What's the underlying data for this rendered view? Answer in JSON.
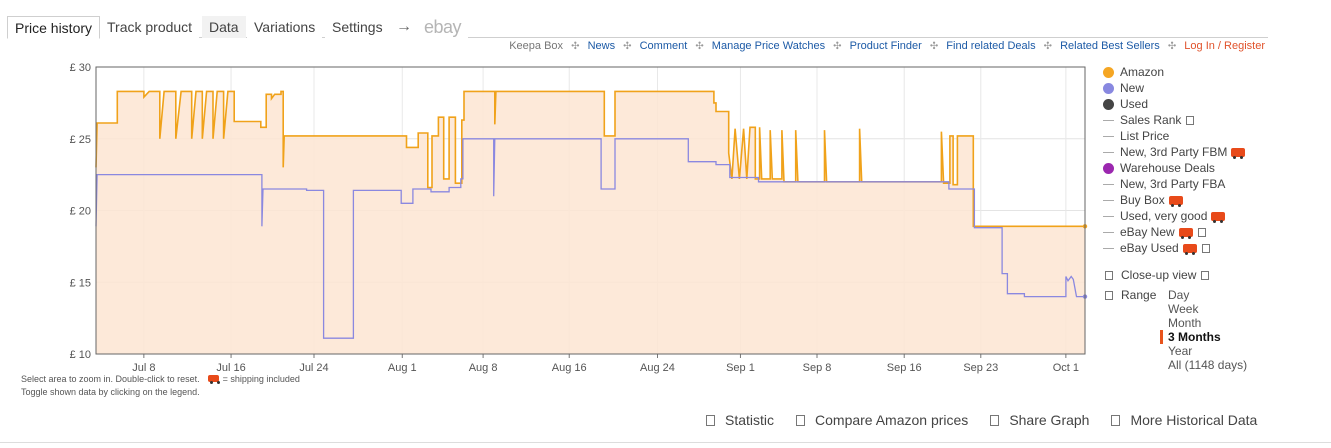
{
  "tabs": {
    "price_history": "Price history",
    "track_product": "Track product",
    "data": "Data",
    "variations": "Variations",
    "settings": "Settings",
    "arrow": "→",
    "ebay": "ebay"
  },
  "top_links": {
    "keepa_box": "Keepa Box",
    "news": "News",
    "comment": "Comment",
    "manage_price_watches": "Manage Price Watches",
    "product_finder": "Product Finder",
    "find_related_deals": "Find related Deals",
    "related_best_sellers": "Related Best Sellers",
    "login_register": "Log In / Register",
    "separator": "✣"
  },
  "chart_data": {
    "type": "line",
    "y_ticks": [
      "£ 30",
      "£ 25",
      "£ 20",
      "£ 15",
      "£ 10"
    ],
    "x_ticks": [
      "Jul 8",
      "Jul 16",
      "Jul 24",
      "Aug 1",
      "Aug 8",
      "Aug 16",
      "Aug 24",
      "Sep 1",
      "Sep 8",
      "Sep 16",
      "Sep 23",
      "Oct 1"
    ],
    "ylim": [
      10,
      30
    ],
    "x_range_days": [
      0,
      93
    ],
    "x_unit": "days from Jul 4",
    "grid": true,
    "colors": {
      "amazon": "#f0a21a",
      "new": "#8a88e0",
      "fill": "#fde5d2"
    },
    "series": [
      {
        "name": "Amazon",
        "points": [
          [
            0,
            23.0
          ],
          [
            0.1,
            26.1
          ],
          [
            2,
            26.1
          ],
          [
            2,
            28.3
          ],
          [
            4.5,
            28.3
          ],
          [
            4.5,
            27.9
          ],
          [
            5,
            28.3
          ],
          [
            6,
            28.3
          ],
          [
            6,
            25.0
          ],
          [
            6.4,
            28.3
          ],
          [
            7.5,
            28.3
          ],
          [
            7.5,
            25.0
          ],
          [
            8,
            28.3
          ],
          [
            9,
            28.3
          ],
          [
            9,
            25.0
          ],
          [
            9.4,
            28.3
          ],
          [
            10,
            28.3
          ],
          [
            10,
            25.0
          ],
          [
            10.4,
            28.3
          ],
          [
            11,
            28.3
          ],
          [
            11,
            25.0
          ],
          [
            11.4,
            28.3
          ],
          [
            12,
            28.3
          ],
          [
            12,
            25.0
          ],
          [
            12.4,
            28.3
          ],
          [
            13,
            28.3
          ],
          [
            13,
            26.2
          ],
          [
            15.5,
            26.2
          ],
          [
            15.5,
            25.8
          ],
          [
            16,
            25.8
          ],
          [
            16,
            28.1
          ],
          [
            16.5,
            28.1
          ],
          [
            16.5,
            27.8
          ],
          [
            16.8,
            28.1
          ],
          [
            17.4,
            28.1
          ],
          [
            17.4,
            28.3
          ],
          [
            17.6,
            28.3
          ],
          [
            17.6,
            23.0
          ],
          [
            17.7,
            25.2
          ],
          [
            29.2,
            25.2
          ],
          [
            29.2,
            24.4
          ],
          [
            30.3,
            24.4
          ],
          [
            30.3,
            25.4
          ],
          [
            31.2,
            25.4
          ],
          [
            31.2,
            21.6
          ],
          [
            31.6,
            21.6
          ],
          [
            31.6,
            25.2
          ],
          [
            32.2,
            25.2
          ],
          [
            32.2,
            26.5
          ],
          [
            32.7,
            26.5
          ],
          [
            32.7,
            22.2
          ],
          [
            33.2,
            22.2
          ],
          [
            33.2,
            26.5
          ],
          [
            33.8,
            26.5
          ],
          [
            33.8,
            21.9
          ],
          [
            34.4,
            21.9
          ],
          [
            34.4,
            26.3
          ],
          [
            34.6,
            26.3
          ],
          [
            34.6,
            28.3
          ],
          [
            37.5,
            28.3
          ],
          [
            37.5,
            26.0
          ],
          [
            37.6,
            28.3
          ],
          [
            47.8,
            28.3
          ],
          [
            47.8,
            25.2
          ],
          [
            48.8,
            25.2
          ],
          [
            48.8,
            28.3
          ],
          [
            58.1,
            28.3
          ],
          [
            58.1,
            27.5
          ],
          [
            58.3,
            27.5
          ],
          [
            58.3,
            26.9
          ],
          [
            59.5,
            26.9
          ],
          [
            59.5,
            24.0
          ],
          [
            59.8,
            22.2
          ],
          [
            60.1,
            25.7
          ],
          [
            60.5,
            22.2
          ],
          [
            60.9,
            25.7
          ],
          [
            61.2,
            22.2
          ],
          [
            61.5,
            25.8
          ],
          [
            62,
            25.8
          ],
          [
            62,
            22.2
          ],
          [
            62.4,
            22.2
          ],
          [
            62.4,
            25.8
          ],
          [
            62.6,
            22.2
          ],
          [
            63.4,
            22.2
          ],
          [
            63.4,
            25.6
          ],
          [
            63.6,
            22.2
          ],
          [
            64.5,
            22.2
          ],
          [
            64.5,
            25.6
          ],
          [
            64.7,
            22.0
          ],
          [
            65.8,
            22.0
          ],
          [
            65.8,
            25.6
          ],
          [
            66,
            22.0
          ],
          [
            68.5,
            22.0
          ],
          [
            68.5,
            25.6
          ],
          [
            68.7,
            22.0
          ],
          [
            71.8,
            22.0
          ],
          [
            71.8,
            25.7
          ],
          [
            72,
            22.0
          ],
          [
            79.5,
            22.0
          ],
          [
            79.5,
            25.5
          ],
          [
            79.7,
            21.9
          ],
          [
            80.3,
            21.9
          ],
          [
            80.3,
            25.2
          ],
          [
            80.6,
            25.2
          ],
          [
            80.6,
            21.8
          ],
          [
            81,
            21.8
          ],
          [
            81,
            25.2
          ],
          [
            82.5,
            25.2
          ],
          [
            82.5,
            18.9
          ],
          [
            93,
            18.9
          ]
        ]
      },
      {
        "name": "New",
        "points": [
          [
            0,
            18.9
          ],
          [
            0.1,
            22.5
          ],
          [
            15.6,
            22.5
          ],
          [
            15.6,
            18.9
          ],
          [
            15.7,
            21.5
          ],
          [
            19.8,
            21.5
          ],
          [
            19.8,
            21.4
          ],
          [
            21.4,
            21.4
          ],
          [
            21.4,
            11.1
          ],
          [
            24.2,
            11.1
          ],
          [
            24.2,
            21.4
          ],
          [
            28.7,
            21.4
          ],
          [
            28.7,
            20.5
          ],
          [
            29.8,
            20.5
          ],
          [
            29.8,
            21.5
          ],
          [
            31.5,
            21.5
          ],
          [
            31.5,
            21.3
          ],
          [
            33.2,
            21.3
          ],
          [
            33.2,
            21.6
          ],
          [
            34.3,
            21.6
          ],
          [
            34.3,
            22.2
          ],
          [
            34.5,
            22.2
          ],
          [
            34.5,
            25.0
          ],
          [
            37.4,
            25.0
          ],
          [
            37.4,
            21.0
          ],
          [
            37.5,
            25.0
          ],
          [
            47.5,
            25.0
          ],
          [
            47.5,
            21.5
          ],
          [
            48.8,
            21.5
          ],
          [
            48.8,
            25.0
          ],
          [
            55.7,
            25.0
          ],
          [
            55.7,
            23.4
          ],
          [
            58.3,
            23.4
          ],
          [
            58.3,
            23.2
          ],
          [
            59.6,
            23.2
          ],
          [
            59.6,
            22.3
          ],
          [
            62.3,
            22.3
          ],
          [
            62.3,
            22.0
          ],
          [
            80.2,
            22.0
          ],
          [
            80.2,
            21.5
          ],
          [
            82.6,
            21.5
          ],
          [
            82.6,
            18.8
          ],
          [
            85.2,
            18.8
          ],
          [
            85.2,
            15.6
          ],
          [
            85.7,
            15.6
          ],
          [
            85.7,
            14.2
          ],
          [
            87.3,
            14.2
          ],
          [
            87.3,
            14.0
          ],
          [
            91.2,
            14.0
          ],
          [
            91.2,
            15.4
          ],
          [
            91.4,
            15.1
          ],
          [
            91.7,
            15.4
          ],
          [
            91.9,
            15.2
          ],
          [
            92.2,
            14.0
          ],
          [
            93,
            14.0
          ]
        ]
      }
    ]
  },
  "legend": {
    "amazon": "Amazon",
    "new": "New",
    "used": "Used",
    "sales_rank": "Sales Rank",
    "list_price": "List Price",
    "new_3p_fbm": "New, 3rd Party FBM",
    "warehouse_deals": "Warehouse Deals",
    "new_3p_fba": "New, 3rd Party FBA",
    "buy_box": "Buy Box",
    "used_very_good": "Used, very good",
    "ebay_new": "eBay New",
    "ebay_used": "eBay Used",
    "colors": {
      "amazon": "#f5a623",
      "new": "#8888e0",
      "used": "#444444",
      "warehouse": "#9b27af"
    }
  },
  "view": {
    "close_up": "Close-up view",
    "range": "Range",
    "range_options": [
      "Day",
      "Week",
      "Month",
      "3 Months",
      "Year",
      "All (1148 days)"
    ],
    "selected_range": "3 Months"
  },
  "hints": {
    "line1": "Select area to zoom in. Double-click to reset.",
    "shipping": "= shipping included",
    "line2": "Toggle shown data by clicking on the legend."
  },
  "bottom": {
    "statistic": "Statistic",
    "compare": "Compare Amazon prices",
    "share": "Share Graph",
    "more": "More Historical Data"
  }
}
